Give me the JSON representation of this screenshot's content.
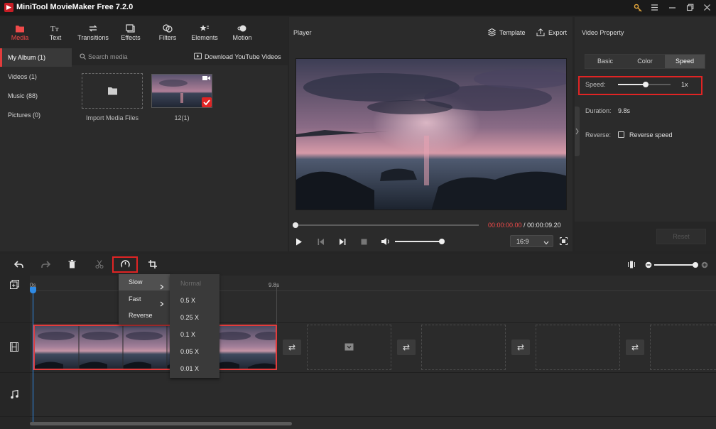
{
  "app": {
    "title": "MiniTool MovieMaker Free 7.2.0"
  },
  "toolbar": {
    "tabs": [
      {
        "label": "Media",
        "icon": "folder-icon"
      },
      {
        "label": "Text",
        "icon": "text-icon"
      },
      {
        "label": "Transitions",
        "icon": "transitions-icon"
      },
      {
        "label": "Effects",
        "icon": "effects-icon"
      },
      {
        "label": "Filters",
        "icon": "filters-icon"
      },
      {
        "label": "Elements",
        "icon": "elements-icon"
      },
      {
        "label": "Motion",
        "icon": "motion-icon"
      }
    ]
  },
  "album": {
    "items": [
      "My Album (1)",
      "Videos (1)",
      "Music (88)",
      "Pictures (0)"
    ]
  },
  "media": {
    "search_placeholder": "Search media",
    "download_label": "Download YouTube Videos",
    "import_label": "Import Media Files",
    "clip_name": "12(1)"
  },
  "player": {
    "title": "Player",
    "template_label": "Template",
    "export_label": "Export",
    "current_time": "00:00:00.00",
    "separator": " / ",
    "total_time": "00:00:09.20",
    "aspect_ratio": "16:9",
    "seek_progress": 0,
    "volume_level": 1.0
  },
  "property": {
    "title": "Video Property",
    "tabs": [
      "Basic",
      "Color",
      "Speed"
    ],
    "selected_tab": "Speed",
    "speed_label": "Speed:",
    "speed_value": "1x",
    "speed_slider_level": 0.53,
    "duration_label": "Duration:",
    "duration_value": "9.8s",
    "reverse_label": "Reverse:",
    "reverse_checkbox_label": "Reverse speed",
    "reset_label": "Reset"
  },
  "timeline": {
    "ruler_start": "0s",
    "ruler_mark": "9.8s",
    "zoom_level": 1.0
  },
  "speed_menu": {
    "items": [
      "Slow",
      "Fast",
      "Reverse"
    ],
    "submenu": [
      "Normal",
      "0.5 X",
      "0.25 X",
      "0.1 X",
      "0.05 X",
      "0.01 X"
    ]
  },
  "colors": {
    "accent": "#e23c3c",
    "highlight_box": "#e02424",
    "playhead": "#2f8be6",
    "background": "#252525"
  }
}
